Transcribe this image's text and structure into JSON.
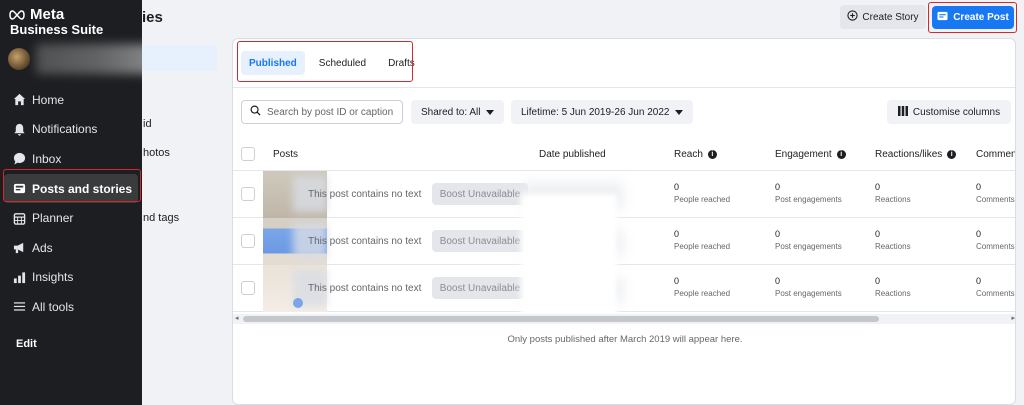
{
  "brand": {
    "name": "Meta",
    "suite": "Business Suite"
  },
  "page": {
    "title": "ies"
  },
  "sidebar": {
    "items": [
      {
        "label": "Home",
        "icon": "home-icon"
      },
      {
        "label": "Notifications",
        "icon": "bell-icon"
      },
      {
        "label": "Inbox",
        "icon": "chat-bubble-icon"
      },
      {
        "label": "Posts and stories",
        "icon": "posts-icon",
        "active": true
      },
      {
        "label": "Planner",
        "icon": "calendar-icon"
      },
      {
        "label": "Ads",
        "icon": "megaphone-icon"
      },
      {
        "label": "Insights",
        "icon": "bar-chart-icon"
      },
      {
        "label": "All tools",
        "icon": "menu-icon"
      }
    ],
    "edit_label": "Edit"
  },
  "subnav": {
    "item1": "id",
    "item2": "hotos",
    "item3": "nd tags"
  },
  "header": {
    "create_story": "Create Story",
    "create_post": "Create Post"
  },
  "tabs": [
    "Published",
    "Scheduled",
    "Drafts"
  ],
  "filters": {
    "search_placeholder": "Search by post ID or caption",
    "shared_to": "Shared to: All",
    "lifetime": "Lifetime: 5 Jun 2019-26 Jun 2022",
    "customise": "Customise columns"
  },
  "table": {
    "columns": [
      "Posts",
      "Date published",
      "Reach",
      "Engagement",
      "Reactions/likes",
      "Comment"
    ],
    "rows": [
      {
        "text": "This post contains no text",
        "boost": "Boost Unavailable",
        "reach": "0",
        "reach_label": "People reached",
        "engagement": "0",
        "engagement_label": "Post engagements",
        "reactions": "0",
        "reactions_label": "Reactions",
        "comments": "0",
        "comments_label": "Comments"
      },
      {
        "text": "This post contains no text",
        "boost": "Boost Unavailable",
        "reach": "0",
        "reach_label": "People reached",
        "engagement": "0",
        "engagement_label": "Post engagements",
        "reactions": "0",
        "reactions_label": "Reactions",
        "comments": "0",
        "comments_label": "Comments"
      },
      {
        "text": "This post contains no text",
        "boost": "Boost Unavailable",
        "reach": "0",
        "reach_label": "People reached",
        "engagement": "0",
        "engagement_label": "Post engagements",
        "reactions": "0",
        "reactions_label": "Reactions",
        "comments": "0",
        "comments_label": "Comments"
      }
    ]
  },
  "footnote": "Only posts published after March 2019 will appear here.",
  "colors": {
    "accent": "#1877f2",
    "sidebar_bg": "#1c1e21",
    "highlight": "#d8262d"
  }
}
